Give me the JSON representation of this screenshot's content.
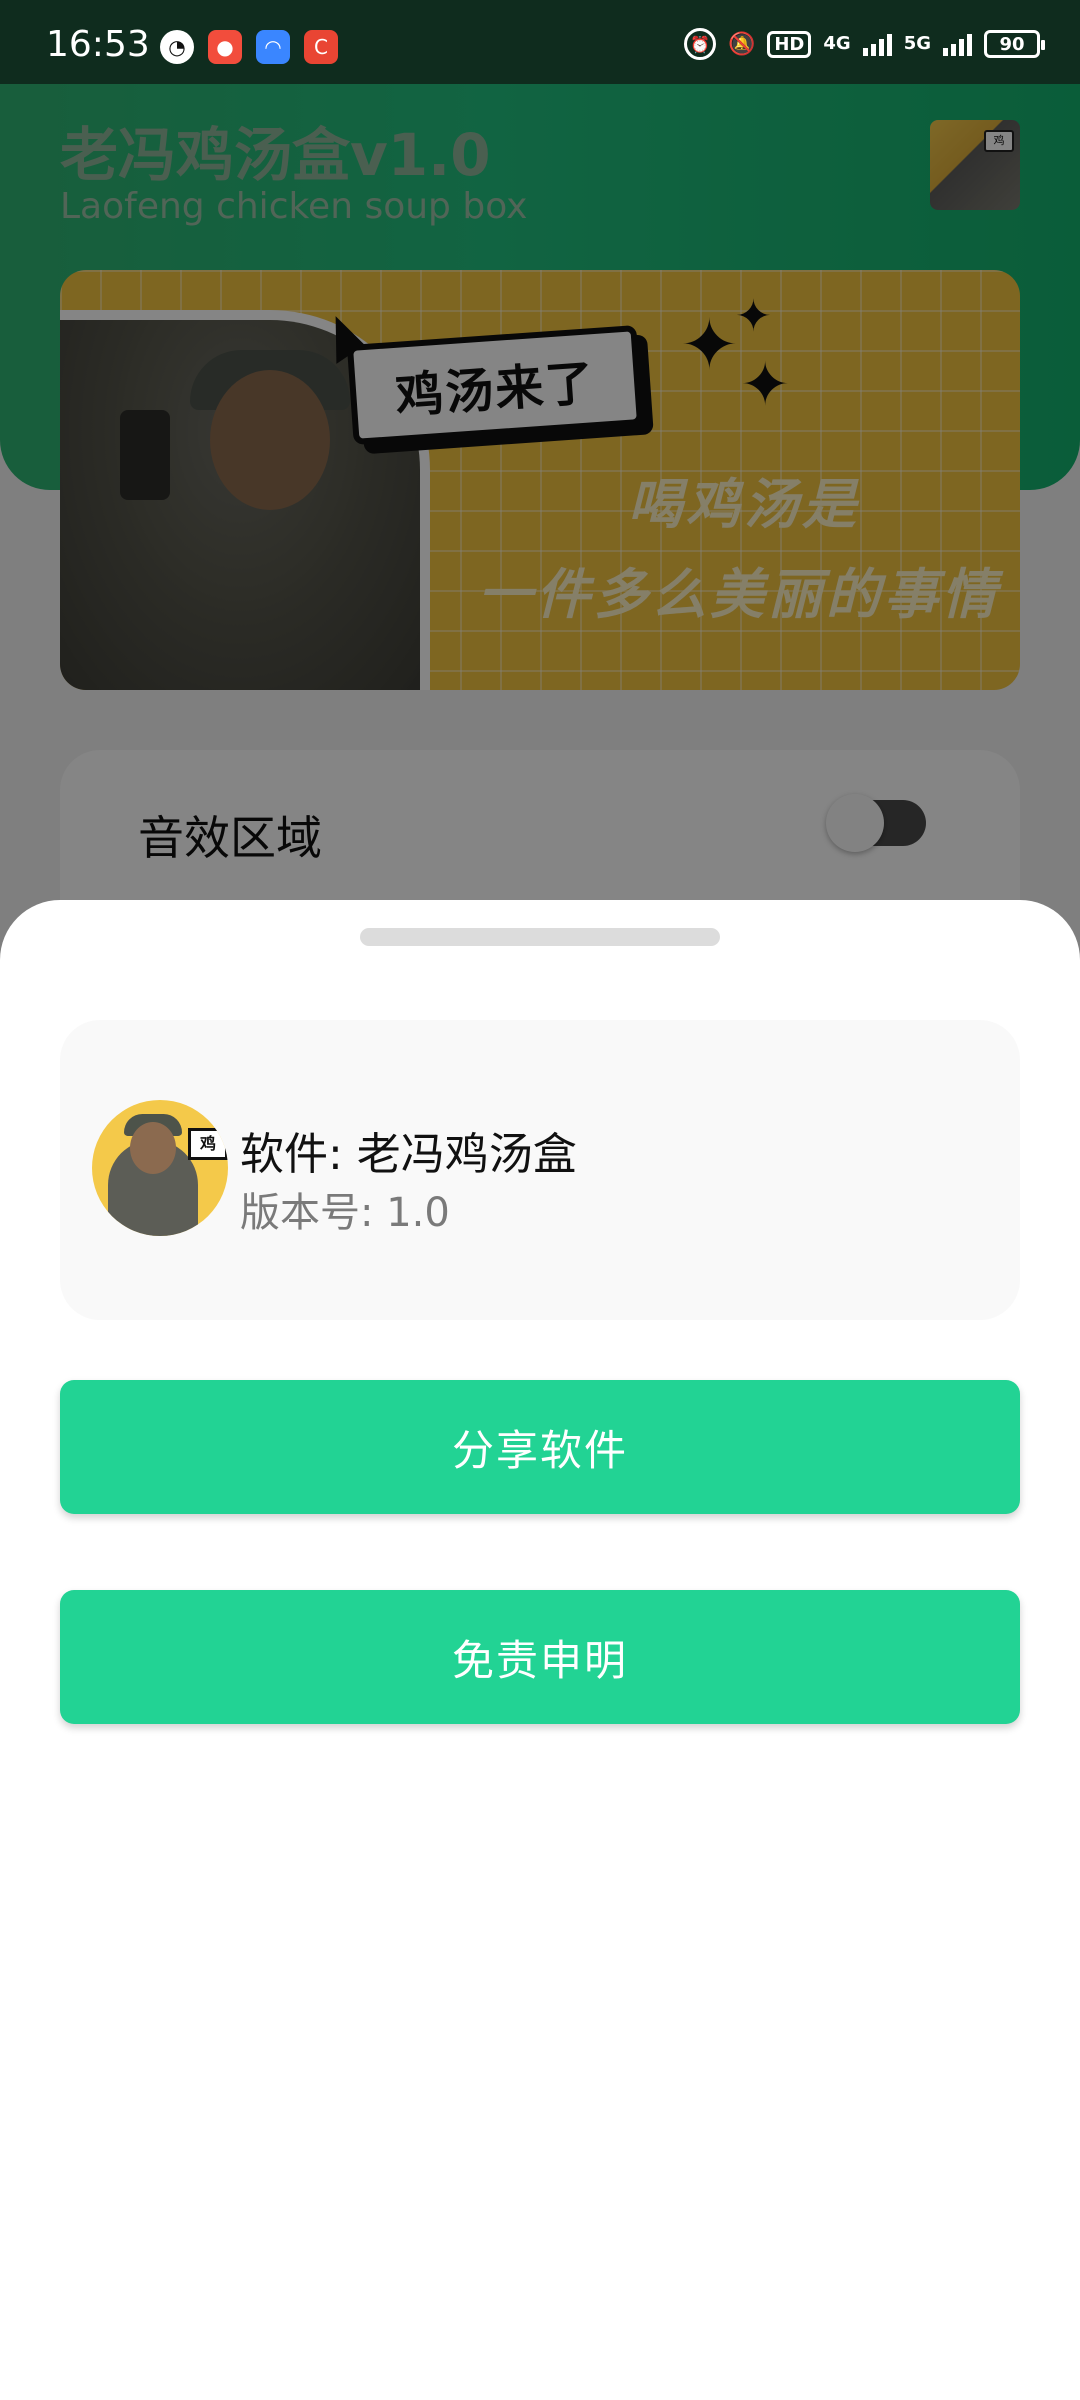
{
  "status_bar": {
    "time": "16:53",
    "app_icons": [
      "speedometer-icon",
      "app-red-icon",
      "app-blue-icon",
      "app-red-c-icon"
    ],
    "network_hd": "HD",
    "network_4g": "4G",
    "network_5g": "5G",
    "battery": "90"
  },
  "app": {
    "title": "老冯鸡汤盒v1.0",
    "subtitle": "Laofeng chicken soup box",
    "banner": {
      "speech": "鸡汤来了",
      "slogan_line1": "喝鸡汤是",
      "slogan_line2": "一件多么美丽的事情"
    },
    "sound_section": {
      "label": "音效区域",
      "toggle_on": false
    }
  },
  "sheet": {
    "app_name": "软件: 老冯鸡汤盒",
    "version": "版本号: 1.0",
    "avatar_tag": "鸡",
    "share_button": "分享软件",
    "disclaimer_button": "免责申明"
  },
  "colors": {
    "header_green": "#22c07f",
    "button_green": "#22d394",
    "banner_yellow": "#f2c340"
  }
}
